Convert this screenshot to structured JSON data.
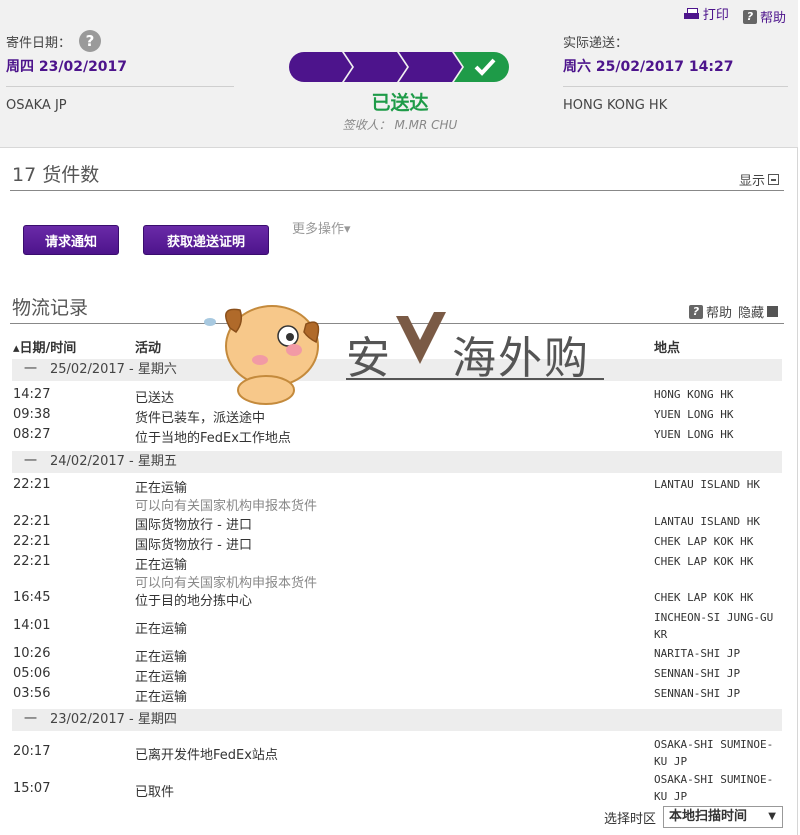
{
  "toolbar": {
    "print": "打印",
    "help": "帮助"
  },
  "header": {
    "ship_label": "寄件日期：",
    "ship_date": "周四 23/02/2017",
    "origin": "OSAKA JP",
    "actual_label": "实际递送：",
    "actual_date": "周六 25/02/2017 14:27",
    "destination": "HONG KONG HK",
    "status": "已送达",
    "signed_by": "签收人： M.MR CHU",
    "progress_steps": 4,
    "progress_done": 4,
    "colors": {
      "purple": "#4d148c",
      "green": "#1e9b48"
    }
  },
  "pieces": {
    "title": "17 货件数",
    "toggle": "显示",
    "notify_button": "请求通知",
    "proof_button": "获取递送证明",
    "more_actions": "更多操作▾"
  },
  "history": {
    "title": "物流记录",
    "help": "帮助",
    "hide": "隐藏",
    "col_datetime": "▴日期/时间",
    "col_activity": "活动",
    "col_location": "地点",
    "days": [
      {
        "date": "一　25/02/2017 - 星期六",
        "events": [
          {
            "time": "14:27",
            "activity": "已送达",
            "sub": "",
            "location": "HONG KONG HK"
          },
          {
            "time": "09:38",
            "activity": "货件已装车，派送途中",
            "sub": "",
            "location": "YUEN LONG HK"
          },
          {
            "time": "08:27",
            "activity": "位于当地的FedEx工作地点",
            "sub": "",
            "location": "YUEN LONG HK"
          }
        ]
      },
      {
        "date": "一　24/02/2017 - 星期五",
        "events": [
          {
            "time": "22:21",
            "activity": "正在运输",
            "sub": "可以向有关国家机构申报本货件",
            "location": "LANTAU ISLAND HK"
          },
          {
            "time": "22:21",
            "activity": "国际货物放行 - 进口",
            "sub": "",
            "location": "LANTAU ISLAND HK"
          },
          {
            "time": "22:21",
            "activity": "国际货物放行 - 进口",
            "sub": "",
            "location": "CHEK LAP KOK HK"
          },
          {
            "time": "22:21",
            "activity": "正在运输",
            "sub": "可以向有关国家机构申报本货件",
            "location": "CHEK LAP KOK HK"
          },
          {
            "time": "16:45",
            "activity": "位于目的地分拣中心",
            "sub": "",
            "location": "CHEK LAP KOK HK"
          },
          {
            "time": "14:01",
            "activity": "正在运输",
            "sub": "",
            "location": "INCHEON-SI JUNG-GU KR"
          },
          {
            "time": "10:26",
            "activity": "正在运输",
            "sub": "",
            "location": "NARITA-SHI JP"
          },
          {
            "time": "05:06",
            "activity": "正在运输",
            "sub": "",
            "location": "SENNAN-SHI JP"
          },
          {
            "time": "03:56",
            "activity": "正在运输",
            "sub": "",
            "location": "SENNAN-SHI JP"
          }
        ]
      },
      {
        "date": "一　23/02/2017 - 星期四",
        "events": [
          {
            "time": "20:17",
            "activity": "已离开发件地FedEx站点",
            "sub": "",
            "location": "OSAKA-SHI SUMINOE-KU JP"
          },
          {
            "time": "15:07",
            "activity": "已取件",
            "sub": "",
            "location": "OSAKA-SHI SUMINOE-KU JP"
          }
        ]
      }
    ]
  },
  "watermark": {
    "text_left": "安",
    "text_right": "海外购"
  },
  "timezone": {
    "label": "选择时区",
    "selected": "本地扫描时间"
  }
}
